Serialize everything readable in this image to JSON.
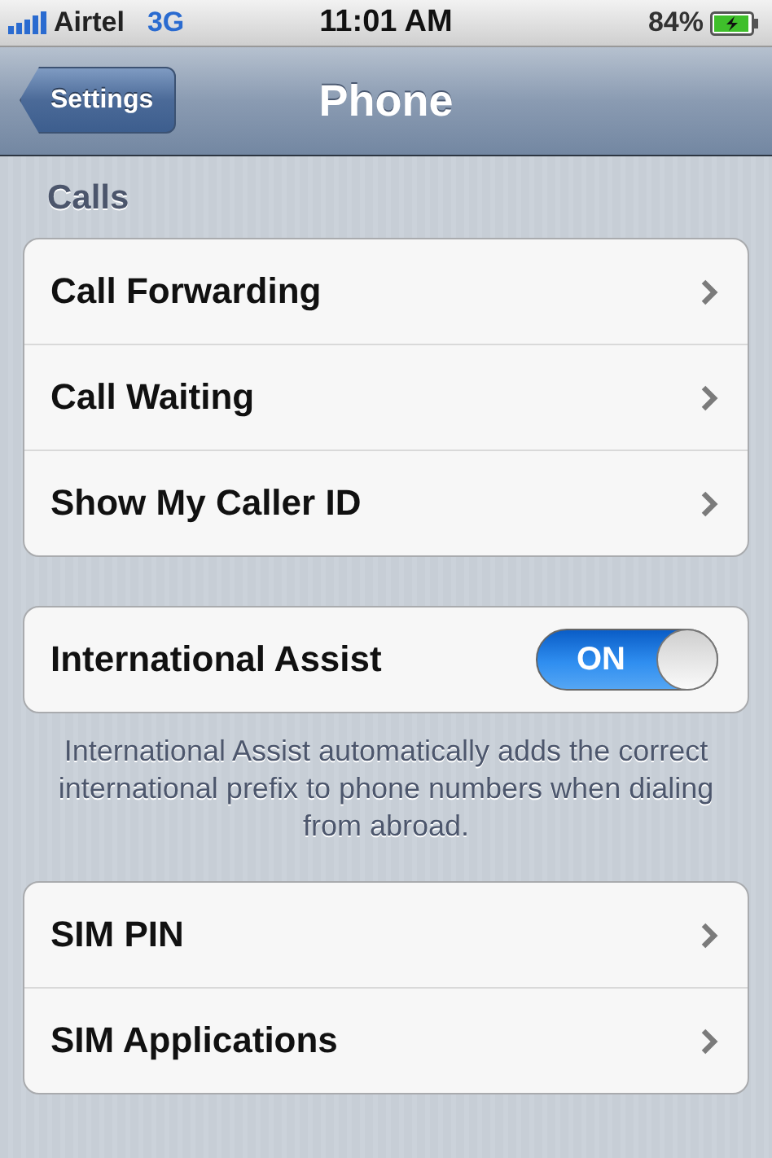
{
  "status_bar": {
    "carrier": "Airtel",
    "network": "3G",
    "time": "11:01 AM",
    "battery": "84%"
  },
  "nav_bar": {
    "back_button": "Settings",
    "title": "Phone"
  },
  "sections": [
    {
      "header": "Calls",
      "rows": [
        {
          "kind": "disclosure",
          "label": "Call Forwarding"
        },
        {
          "kind": "disclosure",
          "label": "Call Waiting"
        },
        {
          "kind": "disclosure",
          "label": "Show My Caller ID"
        }
      ]
    },
    {
      "rows": [
        {
          "kind": "toggle",
          "label": "International Assist",
          "on": true,
          "on_label": "ON"
        }
      ],
      "footer": "International Assist automatically adds the correct international prefix to phone numbers when dialing from abroad."
    },
    {
      "rows": [
        {
          "kind": "disclosure",
          "label": "SIM PIN"
        },
        {
          "kind": "disclosure",
          "label": "SIM Applications"
        }
      ]
    }
  ]
}
